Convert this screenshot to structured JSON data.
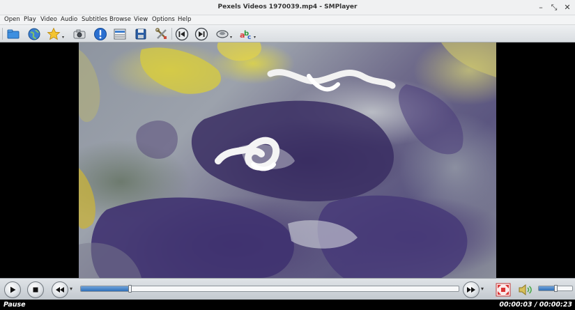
{
  "window": {
    "title": "Pexels Videos 1970039.mp4 - SMPlayer",
    "minimize_glyph": "–",
    "restore_glyph": "⤡",
    "close_glyph": "✕"
  },
  "menu": {
    "items": [
      "Open",
      "Play",
      "Video",
      "Audio",
      "Subtitles",
      "Browse",
      "View",
      "Options",
      "Help"
    ]
  },
  "toolbar": {
    "buttons": [
      {
        "icon": "open-folder-icon"
      },
      {
        "icon": "globe-icon"
      },
      {
        "icon": "favorites-star-icon"
      },
      {
        "icon": "screenshot-camera-icon"
      },
      {
        "icon": "info-icon"
      },
      {
        "icon": "playlist-icon"
      },
      {
        "icon": "save-icon"
      },
      {
        "icon": "preferences-tools-icon"
      },
      {
        "icon": "previous-icon"
      },
      {
        "icon": "next-icon"
      },
      {
        "icon": "audio-track-icon"
      },
      {
        "icon": "subtitles-icon"
      }
    ]
  },
  "controls": {
    "seek_progress": 0.13,
    "volume_level": 0.5
  },
  "status": {
    "state": "Pause",
    "time": "00:00:03 / 00:00:23"
  },
  "colors": {
    "accent": "#2f6fb7",
    "toolbar_bg": "#e3e6e9",
    "status_bg": "#000000"
  }
}
